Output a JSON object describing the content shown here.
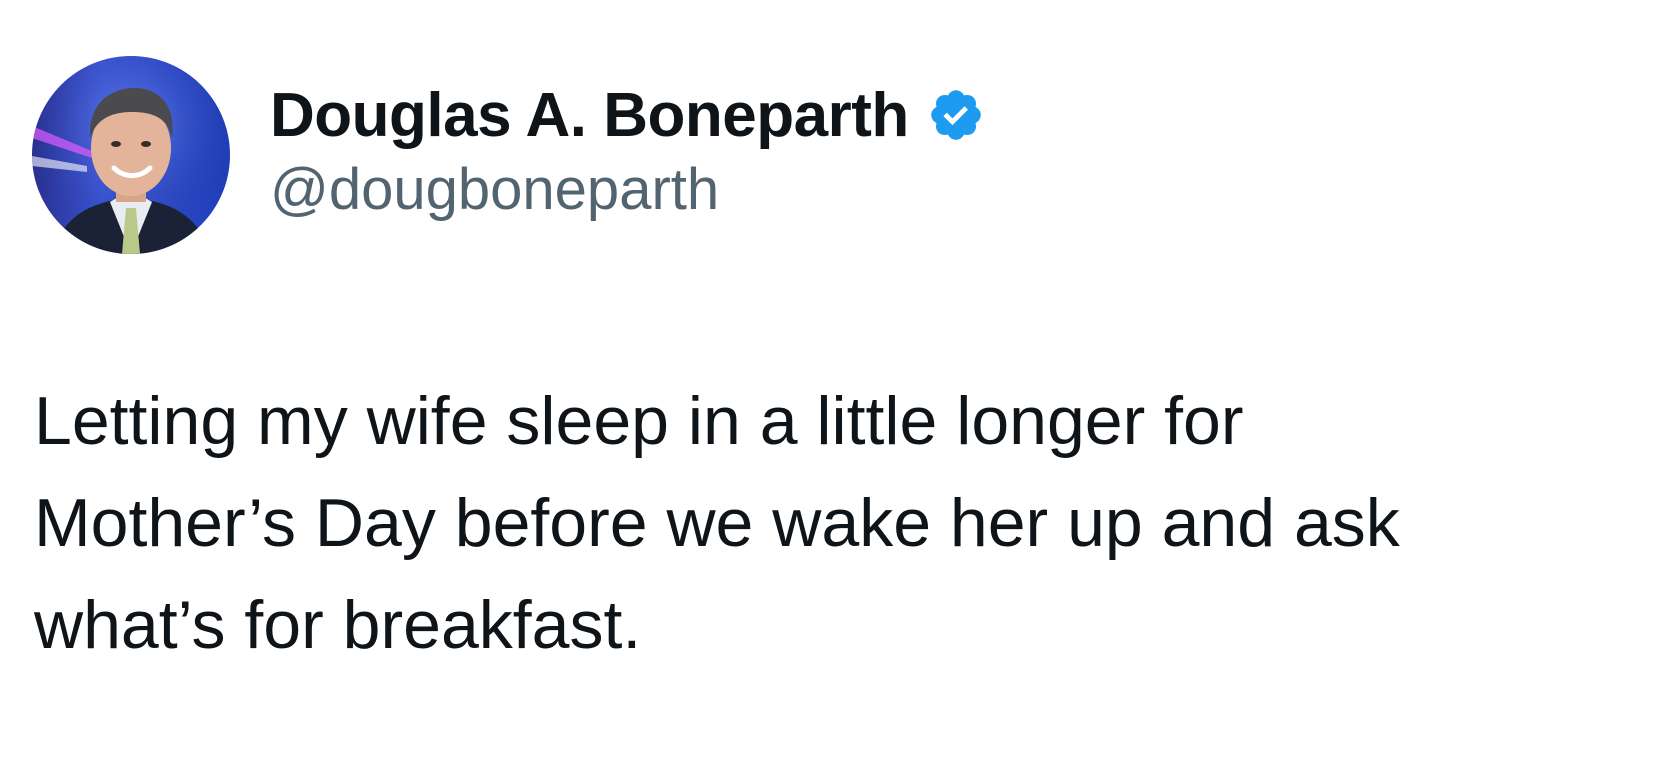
{
  "author": {
    "display_name": "Douglas A. Boneparth",
    "handle": "@dougboneparth",
    "verified_icon": "verified-badge-icon",
    "verified_color": "#1d9bf0"
  },
  "tweet": {
    "lines": [
      "Letting my wife sleep in a little longer for",
      "Mother’s Day before we wake her up and ask",
      "what’s for breakfast."
    ]
  },
  "colors": {
    "text": "#0f1419",
    "handle": "#536471",
    "background": "#ffffff"
  }
}
